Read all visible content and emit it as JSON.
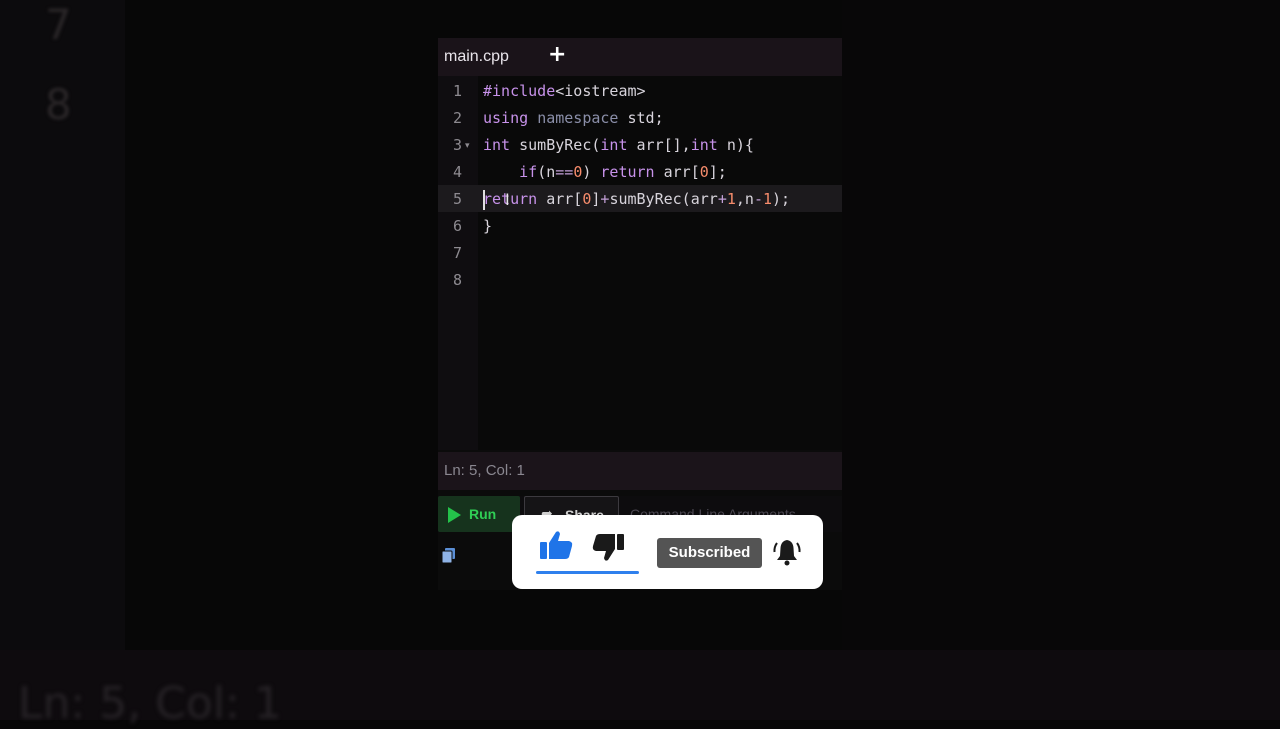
{
  "background": {
    "line_numbers": [
      "7",
      "8"
    ],
    "status_text": "Ln: 5,  Col: 1"
  },
  "editor": {
    "tab": {
      "label": "main.cpp",
      "add_icon": "plus-icon"
    },
    "line_numbers": [
      "1",
      "2",
      "3",
      "4",
      "5",
      "6",
      "7",
      "8"
    ],
    "code_lines": [
      "#include<iostream>",
      "using namespace std;",
      "int sumByRec(int arr[],int n){",
      "    if(n==0) return arr[0];",
      "return arr[0]+sumByRec(arr+1,n-1);",
      "}",
      "",
      ""
    ],
    "current_line": 5,
    "status": "Ln: 5,  Col: 1"
  },
  "toolbar": {
    "run_label": "Run",
    "share_label": "Share",
    "command_line_label": "Command Line Arguments"
  },
  "overlay": {
    "subscribed_label": "Subscribed",
    "icons": [
      "thumbs-up-icon",
      "thumbs-down-icon",
      "bell-icon"
    ]
  },
  "colors": {
    "keyword": "#c792ea",
    "number": "#f78c6c",
    "run_green": "#2fcf55",
    "like_blue": "#2f80ed"
  }
}
